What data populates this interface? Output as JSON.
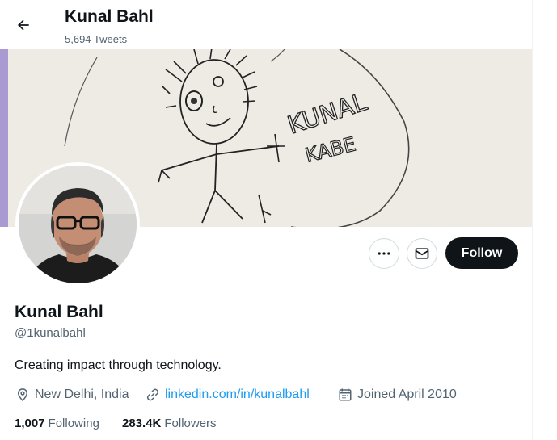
{
  "header": {
    "back_icon": "arrow-left-icon",
    "name": "Kunal Bahl",
    "tweet_count": "5,694 Tweets"
  },
  "banner": {
    "drawing_text_line1": "KUNAL",
    "drawing_text_line2": "KABE"
  },
  "actions": {
    "more_icon": "more-horizontal-icon",
    "message_icon": "envelope-icon",
    "follow_label": "Follow"
  },
  "profile": {
    "name": "Kunal Bahl",
    "handle": "@1kunalbahl",
    "bio": "Creating impact through technology.",
    "location": "New Delhi, India",
    "location_icon": "location-pin-icon",
    "website": "linkedin.com/in/kunalbahl",
    "website_icon": "link-icon",
    "joined": "Joined April 2010",
    "joined_icon": "calendar-icon"
  },
  "stats": {
    "following_count": "1,007",
    "following_label": "Following",
    "followers_count": "283.4K",
    "followers_label": "Followers"
  },
  "colors": {
    "text_primary": "#0f1419",
    "text_secondary": "#536471",
    "link": "#1d9bf0",
    "follow_button_bg": "#0f1419",
    "banner_bg": "#eeebe4"
  }
}
